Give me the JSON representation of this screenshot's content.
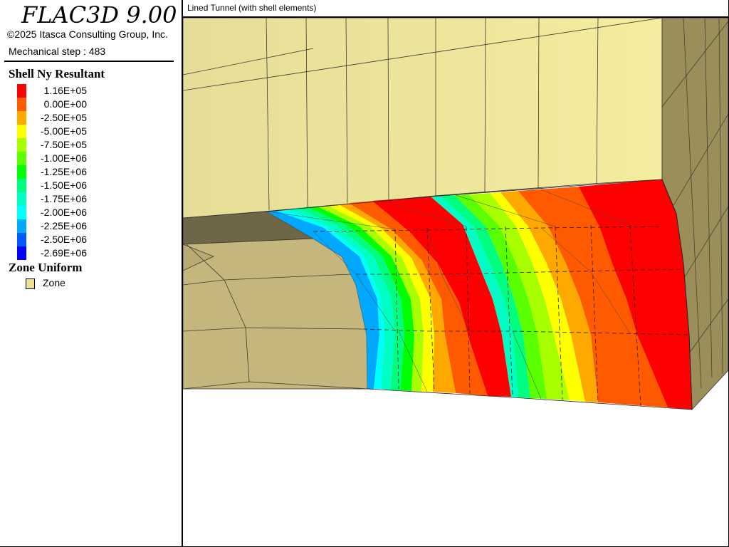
{
  "app": {
    "title": "FLAC3D 9.00",
    "copyright": "©2025 Itasca Consulting Group, Inc.",
    "step_text": "Mechanical step : 483"
  },
  "legend": {
    "shell_title": "Shell Ny Resultant",
    "contours": [
      {
        "label": "1.16E+05",
        "color": "#ff0000"
      },
      {
        "label": "0.00E+00",
        "color": "#ff5a00"
      },
      {
        "label": "-2.50E+05",
        "color": "#ffa800"
      },
      {
        "label": "-5.00E+05",
        "color": "#ffff00"
      },
      {
        "label": "-7.50E+05",
        "color": "#a8ff00"
      },
      {
        "label": "-1.00E+06",
        "color": "#5aff00"
      },
      {
        "label": "-1.25E+06",
        "color": "#00ff00"
      },
      {
        "label": "-1.50E+06",
        "color": "#00ff80"
      },
      {
        "label": "-1.75E+06",
        "color": "#00ffc4"
      },
      {
        "label": "-2.00E+06",
        "color": "#00ffff"
      },
      {
        "label": "-2.25E+06",
        "color": "#00a8ff"
      },
      {
        "label": "-2.50E+06",
        "color": "#005aff"
      },
      {
        "label": "-2.69E+06",
        "color": "#0000ff"
      }
    ],
    "zone_title": "Zone Uniform",
    "zone_item_label": "Zone",
    "zone_color": "#ede191"
  },
  "view": {
    "caption": "Lined Tunnel (with shell elements)"
  }
}
